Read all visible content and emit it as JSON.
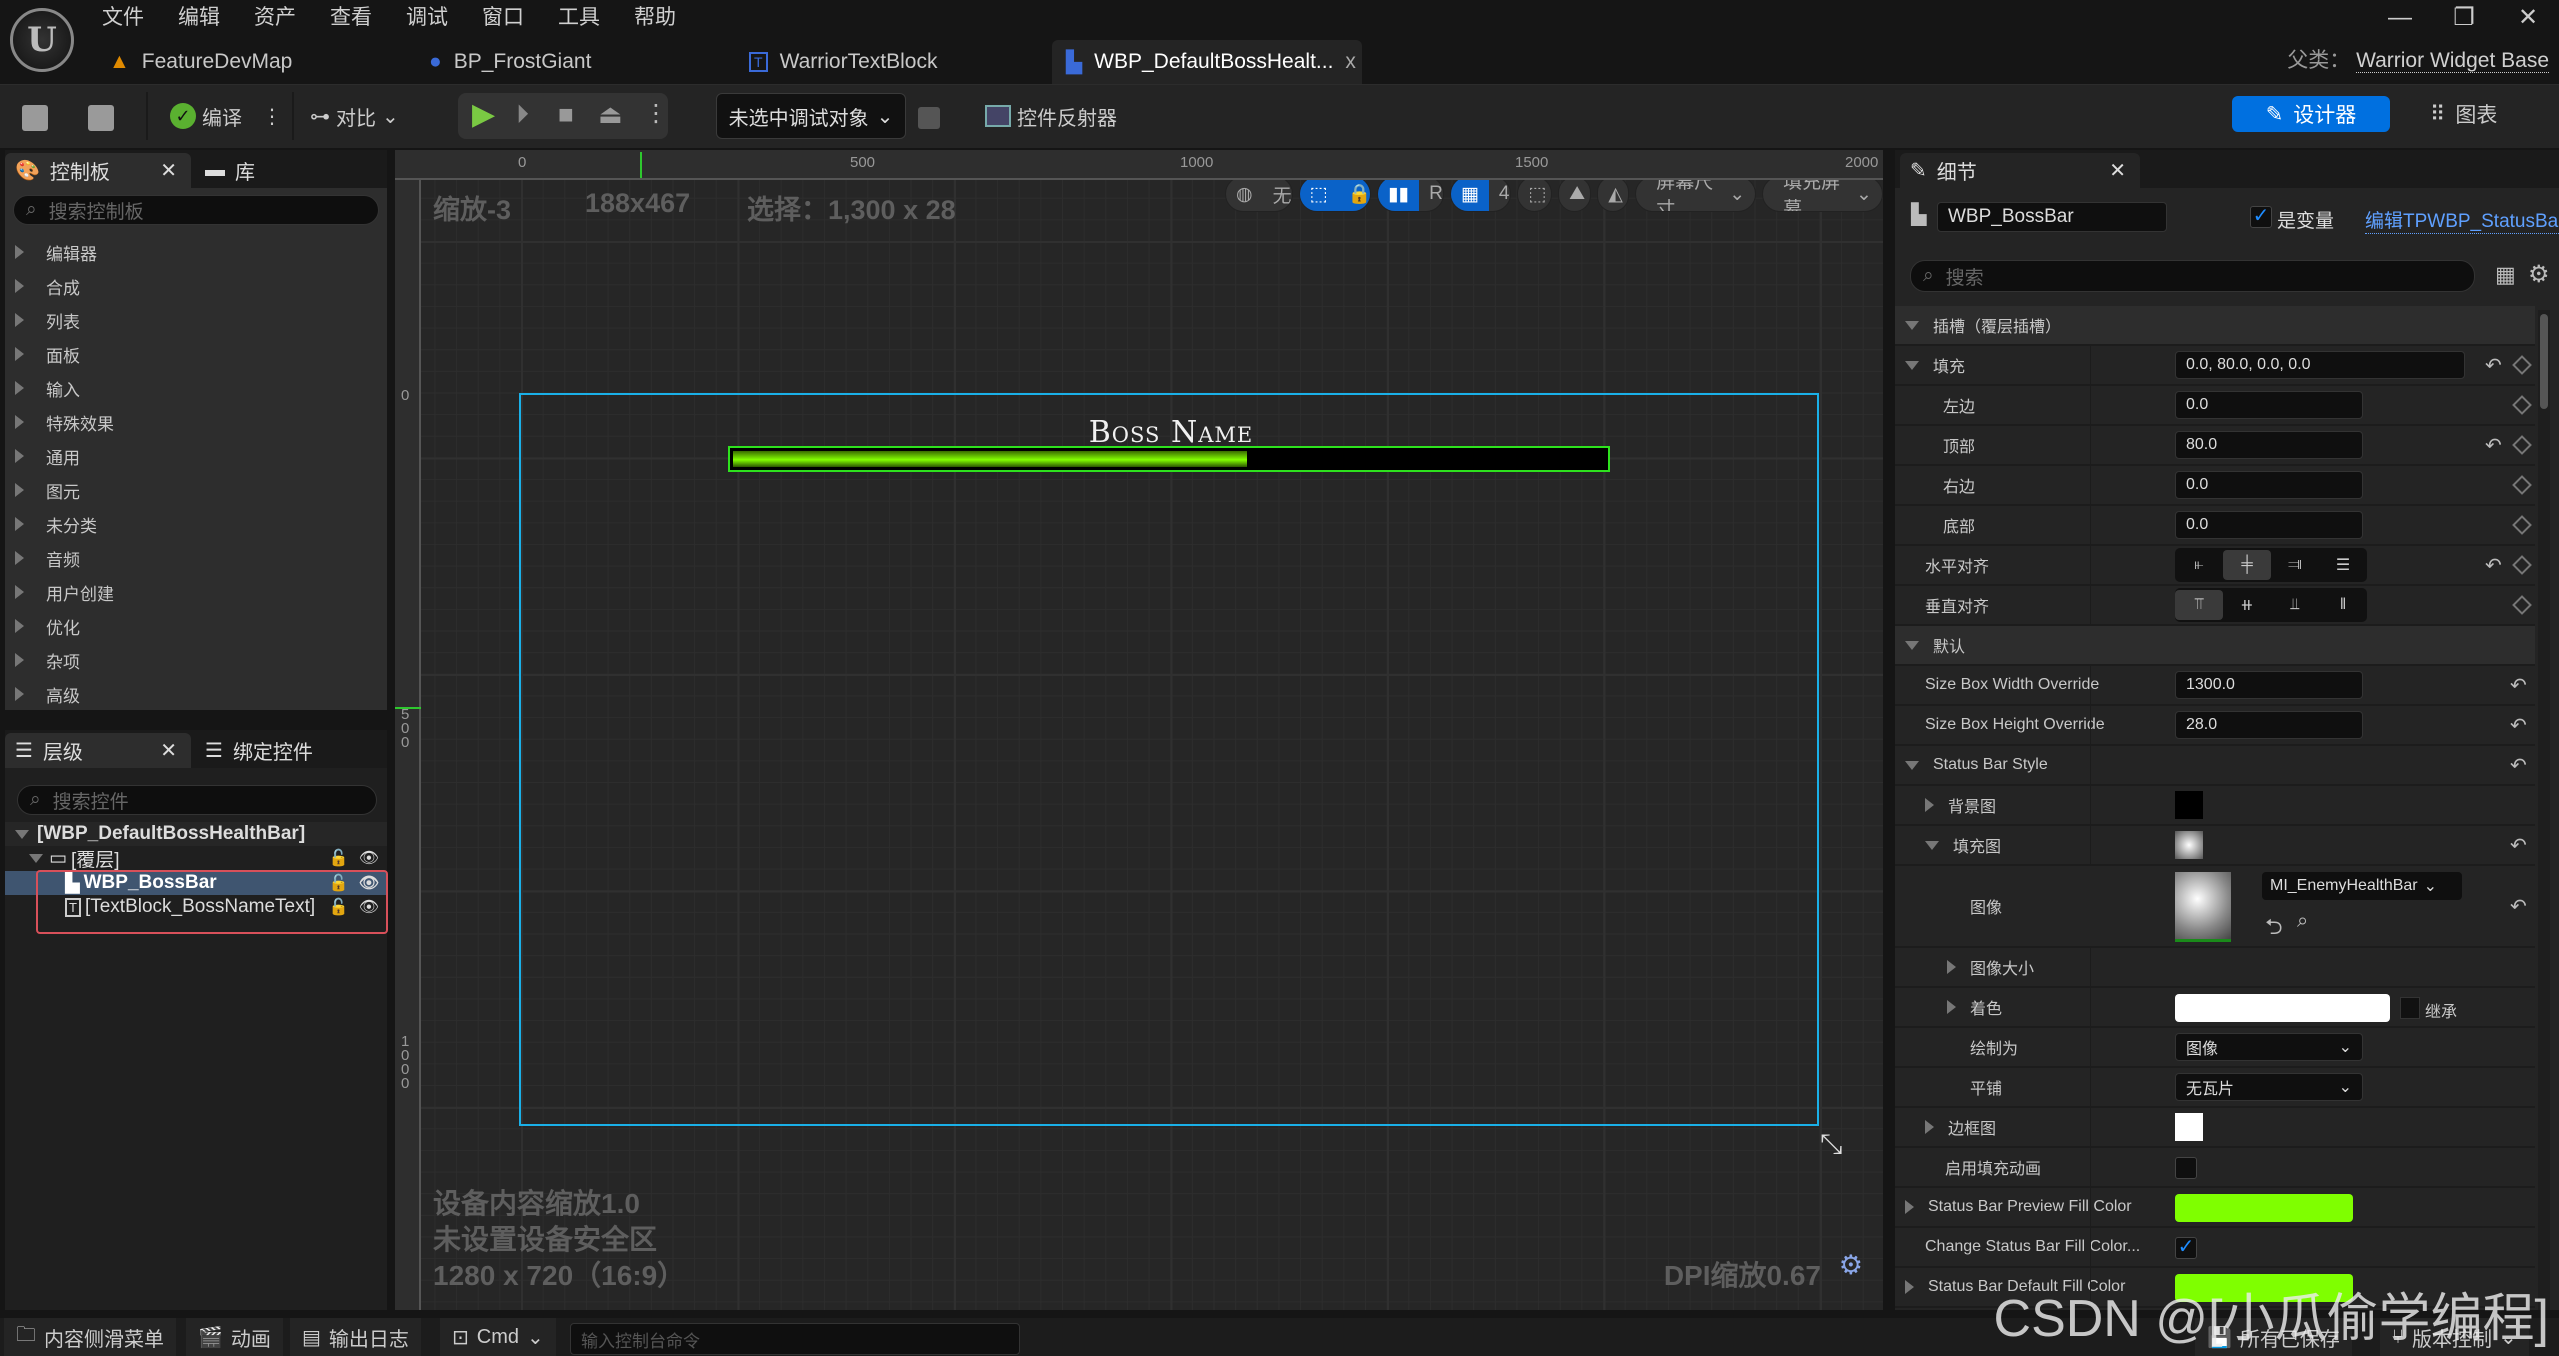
{
  "menu": [
    "文件",
    "编辑",
    "资产",
    "查看",
    "调试",
    "窗口",
    "工具",
    "帮助"
  ],
  "doc_tabs": [
    {
      "label": "FeatureDevMap",
      "icon": "level-icon"
    },
    {
      "label": "BP_FrostGiant",
      "icon": "character-icon"
    },
    {
      "label": "WarriorTextBlock",
      "icon": "textblock-icon"
    },
    {
      "label": "WBP_DefaultBossHealt...",
      "icon": "widget-blueprint-icon",
      "active": true,
      "close": "x"
    }
  ],
  "parent_class": {
    "label": "父类：",
    "value": "Warrior Widget Base"
  },
  "toolbar": {
    "compile": "编译",
    "diff": "对比",
    "debug_target": "未选中调试对象",
    "widget_reflector": "控件反射器",
    "designer": "设计器",
    "graph": "图表"
  },
  "palette": {
    "tab": "控制板",
    "library_tab": "库",
    "search_placeholder": "搜索控制板",
    "categories": [
      "编辑器",
      "合成",
      "列表",
      "面板",
      "输入",
      "特殊效果",
      "通用",
      "图元",
      "未分类",
      "音频",
      "用户创建",
      "优化",
      "杂项",
      "高级"
    ]
  },
  "hierarchy": {
    "tab": "层级",
    "bind_tab": "绑定控件",
    "search_placeholder": "搜索控件",
    "root": "[WBP_DefaultBossHealthBar]",
    "overlay": "[覆层]",
    "items": [
      {
        "label": "WBP_BossBar",
        "selected": true
      },
      {
        "label": "[TextBlock_BossNameText]",
        "selected": false
      }
    ]
  },
  "canvas": {
    "zoom": "缩放-3",
    "size": "188x467",
    "selection": "选择：1,300 x 28",
    "ruler_h": [
      "0",
      "500",
      "1000",
      "1500",
      "2000"
    ],
    "ruler_v": [
      "0",
      "500",
      "1000"
    ],
    "tools": {
      "world": "无",
      "grid_snap": "4",
      "screen_size": "屏幕尺寸",
      "fill_screen": "填充屏幕",
      "r_label": "R"
    },
    "boss_name": "Boss Name",
    "bar_fill_fraction": 0.59,
    "device_scale": "设备内容缩放1.0",
    "safe_zone": "未设置设备安全区",
    "resolution": "1280 x 720（16:9）",
    "dpi": "DPI缩放0.67"
  },
  "details": {
    "tab": "细节",
    "widget_name": "WBP_BossBar",
    "is_variable_label": "是变量",
    "is_variable": true,
    "edit_link": "编辑TPWBP_StatusBar",
    "search_placeholder": "搜索",
    "slot_section": "插槽（覆层插槽）",
    "padding": {
      "label": "填充",
      "value": "0.0, 80.0, 0.0, 0.0",
      "left": {
        "label": "左边",
        "value": "0.0"
      },
      "top": {
        "label": "顶部",
        "value": "80.0"
      },
      "right": {
        "label": "右边",
        "value": "0.0"
      },
      "bottom": {
        "label": "底部",
        "value": "0.0"
      }
    },
    "h_align": "水平对齐",
    "v_align": "垂直对齐",
    "default_section": "默认",
    "width_override": {
      "label": "Size Box Width Override",
      "value": "1300.0"
    },
    "height_override": {
      "label": "Size Box Height Override",
      "value": "28.0"
    },
    "style": "Status Bar Style",
    "bg_image": "背景图",
    "fill_image": "填充图",
    "image": {
      "label": "图像",
      "asset": "MI_EnemyHealthBar"
    },
    "image_size": "图像大小",
    "tint": {
      "label": "着色",
      "inherit": "继承"
    },
    "draw_as": {
      "label": "绘制为",
      "value": "图像"
    },
    "tiling": {
      "label": "平铺",
      "value": "无瓦片"
    },
    "border_image": "边框图",
    "fill_anim": "启用填充动画",
    "preview_fill": {
      "label": "Status Bar Preview Fill Color",
      "color": "#7FFF00"
    },
    "change_fill": {
      "label": "Change Status Bar Fill Color...",
      "checked": true
    },
    "default_fill": {
      "label": "Status Bar Default Fill Color",
      "color": "#7FFF00"
    }
  },
  "statusbar": {
    "content_drawer": "内容侧滑菜单",
    "animation": "动画",
    "output_log": "输出日志",
    "cmd": "Cmd",
    "console_placeholder": "输入控制台命令",
    "all_saved": "所有已保存",
    "source_control": "版本控制"
  },
  "watermark": "CSDN @[小瓜偷学编程]"
}
